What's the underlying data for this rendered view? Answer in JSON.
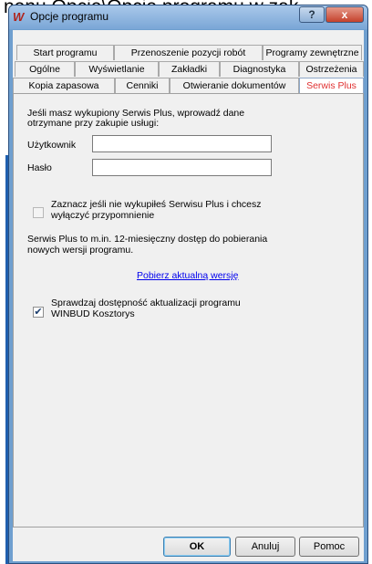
{
  "background_text": "nenu Opcje\\Opcje programu w zak",
  "window": {
    "title": "Opcje programu",
    "help_label": "?",
    "close_label": "x"
  },
  "tabs": {
    "row1": [
      "Start programu",
      "Przenoszenie pozycji robót",
      "Programy zewnętrzne"
    ],
    "row2": [
      "Ogólne",
      "Wyświetlanie",
      "Zakładki",
      "Diagnostyka",
      "Ostrzeżenia"
    ],
    "row3": [
      "Kopia zapasowa",
      "Cenniki",
      "Otwieranie dokumentów",
      "Serwis Plus"
    ],
    "active": "Serwis Plus"
  },
  "serwis": {
    "intro_line1": "Jeśli masz wykupiony Serwis Plus, wprowadź dane",
    "intro_line2": "otrzymane przy zakupie usługi:",
    "user_label": "Użytkownik",
    "user_value": "",
    "password_label": "Hasło",
    "password_value": "",
    "reminder_line1": "Zaznacz jeśli nie wykupiłeś Serwisu Plus i chcesz",
    "reminder_line2": "wyłączyć przypomnienie",
    "reminder_checked": false,
    "info_line1": "Serwis Plus to m.in. 12-miesięczny dostęp do pobierania",
    "info_line2": "nowych wersji programu.",
    "download_link": "Pobierz aktualną wersję",
    "updates_line1": "Sprawdzaj dostępność aktualizacji programu",
    "updates_line2": "WINBUD Kosztorys",
    "updates_checked": true
  },
  "buttons": {
    "ok": "OK",
    "cancel": "Anuluj",
    "help": "Pomoc"
  },
  "colors": {
    "active_tab_text": "#e03030",
    "link": "#0000ee",
    "frame": "#6f9fcf"
  }
}
